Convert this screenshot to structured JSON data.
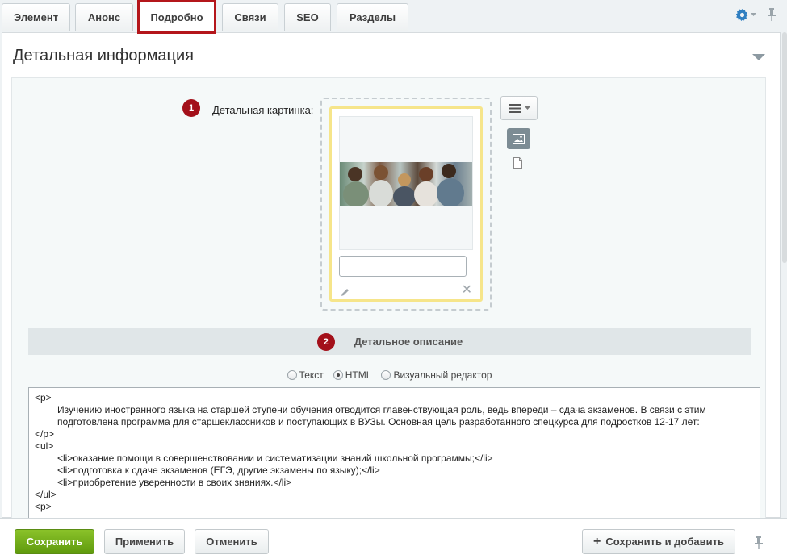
{
  "tabs": [
    {
      "label": "Элемент"
    },
    {
      "label": "Анонс"
    },
    {
      "label": "Подробно"
    },
    {
      "label": "Связи"
    },
    {
      "label": "SEO"
    },
    {
      "label": "Разделы"
    }
  ],
  "panel": {
    "title": "Детальная информация"
  },
  "picture": {
    "badge": "1",
    "label": "Детальная картинка:"
  },
  "description": {
    "badge": "2",
    "header": "Детальное описание"
  },
  "editor_modes": [
    {
      "label": "Текст",
      "selected": false
    },
    {
      "label": "HTML",
      "selected": true
    },
    {
      "label": "Визуальный редактор",
      "selected": false
    }
  ],
  "code_lines": [
    "<p>",
    "Изучению иностранного языка на старшей ступени обучения отводится главенствующая роль, ведь впереди – сдача экзаменов. В связи с этим подготовлена программа для старшеклассников и поступающих в ВУЗы. Основная цель разработанного спецкурса для подростков 12-17 лет:",
    "</p>",
    "<ul>",
    "<li>оказание помощи в совершенствовании и систематизации знаний школьной программы;</li>",
    "<li>подготовка к сдаче экзаменов (ЕГЭ, другие экзамены по языку);</li>",
    "<li>приобретение уверенности в своих знаниях.</li>",
    "</ul>",
    "<p>"
  ],
  "footer": {
    "save": "Сохранить",
    "apply": "Применить",
    "cancel": "Отменить",
    "save_add": "Сохранить и добавить"
  },
  "colors": {
    "accent_red": "#b4161b",
    "badge": "#a3101a",
    "save_green": "#6faa15",
    "gear_blue": "#2f7fc1"
  }
}
